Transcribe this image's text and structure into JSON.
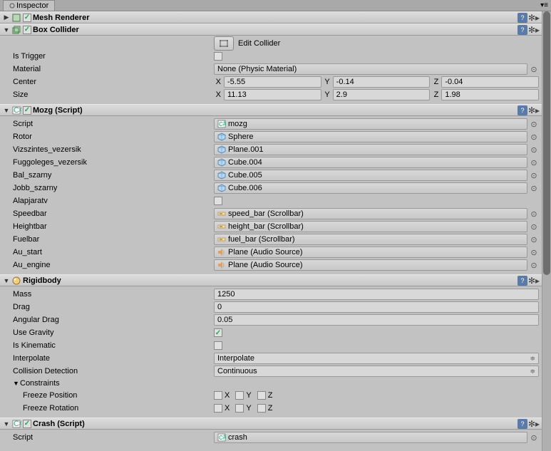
{
  "titlebar": {
    "title": "Inspector"
  },
  "mesh_renderer": {
    "title": "Mesh Renderer",
    "enabled": true
  },
  "box_collider": {
    "title": "Box Collider",
    "enabled": true,
    "edit_collider_label": "Edit Collider",
    "is_trigger_label": "Is Trigger",
    "is_trigger": false,
    "material_label": "Material",
    "material_value": "None (Physic Material)",
    "center_label": "Center",
    "center": {
      "x": "-5.55",
      "y": "-0.14",
      "z": "-0.04"
    },
    "size_label": "Size",
    "size": {
      "x": "11.13",
      "y": "2.9",
      "z": "1.98"
    }
  },
  "mozg": {
    "title": "Mozg (Script)",
    "enabled": true,
    "rows": [
      {
        "label": "Script",
        "value": "mozg",
        "icon": "cs"
      },
      {
        "label": "Rotor",
        "value": "Sphere",
        "icon": "cube"
      },
      {
        "label": "Vizszintes_vezersik",
        "value": "Plane.001",
        "icon": "cube"
      },
      {
        "label": "Fuggoleges_vezersik",
        "value": "Cube.004",
        "icon": "cube"
      },
      {
        "label": "Bal_szarny",
        "value": "Cube.005",
        "icon": "cube"
      },
      {
        "label": "Jobb_szarny",
        "value": "Cube.006",
        "icon": "cube"
      },
      {
        "label": "Alapjaratv",
        "checkbox": false
      },
      {
        "label": "Speedbar",
        "value": "speed_bar (Scrollbar)",
        "icon": "scroll"
      },
      {
        "label": "Heightbar",
        "value": "height_bar (Scrollbar)",
        "icon": "scroll"
      },
      {
        "label": "Fuelbar",
        "value": "fuel_bar (Scrollbar)",
        "icon": "scroll"
      },
      {
        "label": "Au_start",
        "value": "Plane (Audio Source)",
        "icon": "audio"
      },
      {
        "label": "Au_engine",
        "value": "Plane (Audio Source)",
        "icon": "audio"
      }
    ]
  },
  "rigidbody": {
    "title": "Rigidbody",
    "mass_label": "Mass",
    "mass": "1250",
    "drag_label": "Drag",
    "drag": "0",
    "angular_drag_label": "Angular Drag",
    "angular_drag": "0.05",
    "use_gravity_label": "Use Gravity",
    "use_gravity": true,
    "is_kinematic_label": "Is Kinematic",
    "is_kinematic": false,
    "interpolate_label": "Interpolate",
    "interpolate": "Interpolate",
    "collision_label": "Collision Detection",
    "collision": "Continuous",
    "constraints_label": "Constraints",
    "freeze_pos_label": "Freeze Position",
    "freeze_rot_label": "Freeze Rotation",
    "xyz": {
      "x": "X",
      "y": "Y",
      "z": "Z"
    }
  },
  "crash": {
    "title": "Crash (Script)",
    "enabled": true,
    "script_label": "Script",
    "script_value": "crash"
  }
}
